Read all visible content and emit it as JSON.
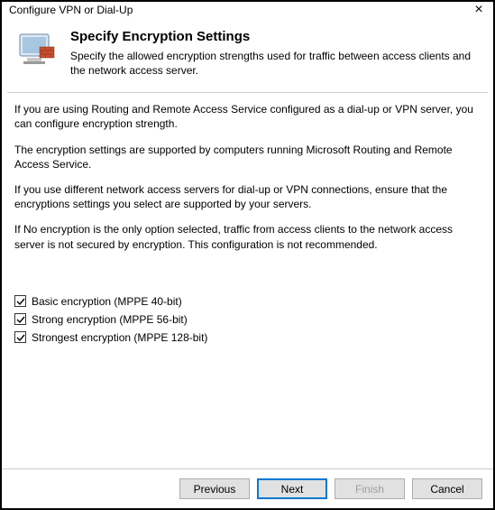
{
  "titlebar": {
    "title": "Configure VPN or Dial-Up"
  },
  "header": {
    "heading": "Specify Encryption Settings",
    "subheading": "Specify the allowed encryption strengths used for traffic between access clients and the network access server."
  },
  "body": {
    "para1": "If you are using Routing and Remote Access Service configured as a dial-up or VPN server, you can configure encryption strength.",
    "para2": "The encryption settings are supported by computers running Microsoft Routing and Remote Access Service.",
    "para3": "If you use different network access servers for dial-up or VPN connections, ensure that the encryptions settings you select are supported by your servers.",
    "para4": "If No encryption is the only option selected, traffic from access clients to the network access server is not secured by encryption. This configuration is not recommended."
  },
  "options": {
    "basic": {
      "label": "Basic encryption (MPPE 40-bit)",
      "checked": true
    },
    "strong": {
      "label": "Strong encryption (MPPE 56-bit)",
      "checked": true
    },
    "strongest": {
      "label": "Strongest encryption (MPPE 128-bit)",
      "checked": true
    }
  },
  "buttons": {
    "previous": "Previous",
    "next": "Next",
    "finish": "Finish",
    "cancel": "Cancel"
  }
}
